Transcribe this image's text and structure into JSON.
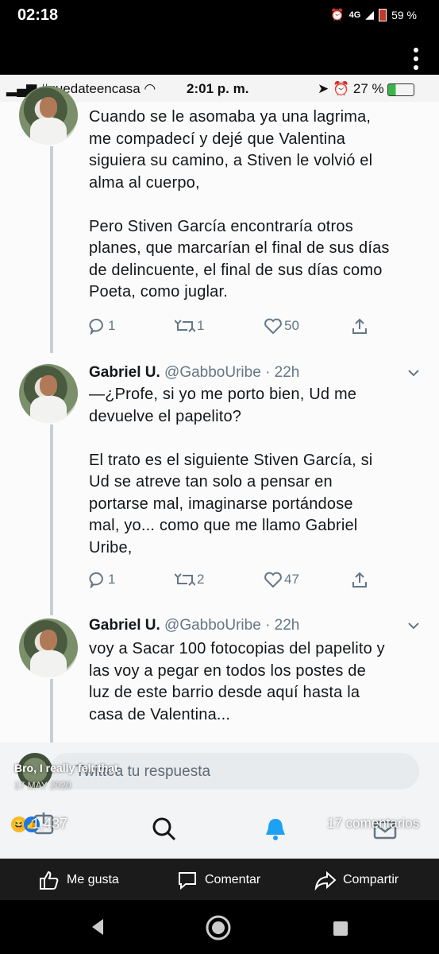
{
  "android_status": {
    "time": "02:18",
    "network": "4G",
    "battery": "59 %"
  },
  "ios_status": {
    "carrier": "#quedateencasa",
    "time": "2:01 p. m.",
    "battery": "27 %"
  },
  "tweets": [
    {
      "text": "Cuando se le asomaba ya una lagrima,\nme compadecí y dejé que Valentina\nsiguiera su camino, a Stiven le volvió el\nalma al cuerpo,\n\nPero Stiven García encontraría otros\nplanes, que marcarían el final de sus días\nde delincuente, el final de sus días como\nPoeta, como juglar.",
      "replies": "1",
      "retweets": "1",
      "likes": "50"
    },
    {
      "name": "Gabriel U.",
      "handle": "@GabboUribe",
      "time": "· 22h",
      "text": "—¿Profe, si yo me porto bien, Ud me\ndevuelve el papelito?\n\nEl trato es el siguiente Stiven García, si\nUd se atreve tan solo a pensar en\nportarse mal, imaginarse portándose\nmal, yo... como que me llamo Gabriel\nUribe,",
      "replies": "1",
      "retweets": "2",
      "likes": "47"
    },
    {
      "name": "Gabriel U.",
      "handle": "@GabboUribe",
      "time": "· 22h",
      "text": "voy a Sacar 100 fotocopias del papelito y\nlas voy a pegar en todos los postes de\nluz de este barrio desde aquí hasta la\ncasa de Valentina..."
    }
  ],
  "reply": {
    "placeholder": "Twittea tu respuesta"
  },
  "post": {
    "caption": "Bro, I really felt that",
    "date": "17 MAY 2020",
    "reactions": "1,437",
    "comments": "17 comentarios"
  },
  "fb_actions": {
    "like": "Me gusta",
    "comment": "Comentar",
    "share": "Compartir"
  },
  "colors": {
    "text": "#14171a",
    "muted": "#657786",
    "like_blue": "#1877f2"
  }
}
